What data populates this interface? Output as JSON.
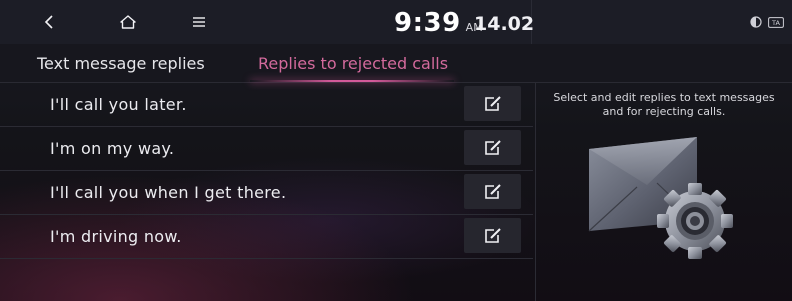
{
  "status_bar": {
    "back_icon": "back-arrow-icon",
    "home_icon": "home-icon",
    "menu_icon": "menu-icon",
    "time": "9:39",
    "ampm": "AM",
    "date": "14.02",
    "status_icons": [
      "media-status-icon",
      "ta-icon"
    ],
    "ta_label": "TA"
  },
  "tabs": [
    {
      "label": "Text message replies",
      "active": false
    },
    {
      "label": "Replies to rejected calls",
      "active": true
    }
  ],
  "replies": [
    {
      "text": "I'll call you later."
    },
    {
      "text": "I'm on my way."
    },
    {
      "text": "I'll call you when I get there."
    },
    {
      "text": "I'm driving now."
    }
  ],
  "edit_icon": "edit-icon",
  "info_text": "Select and edit replies to text messages and for rejecting calls.",
  "illustration_icon": "envelope-settings-icon",
  "colors": {
    "accent": "#d45a9a",
    "background": "#141419",
    "text": "#e9e9ee"
  }
}
